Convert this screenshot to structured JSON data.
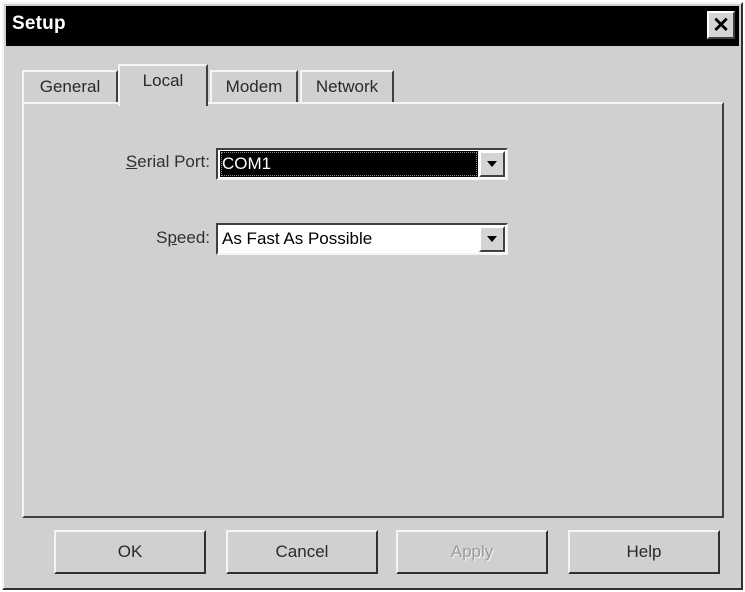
{
  "window": {
    "title": "Setup",
    "close_glyph": "✕"
  },
  "tabs": [
    {
      "label": "General",
      "active": false
    },
    {
      "label": "Local",
      "active": true
    },
    {
      "label": "Modem",
      "active": false
    },
    {
      "label": "Network",
      "active": false
    }
  ],
  "form": {
    "serial_port": {
      "label": "Serial Port:",
      "mnemonic": "S",
      "value": "COM1"
    },
    "speed": {
      "label": "Speed:",
      "mnemonic": "p",
      "value": "As Fast As Possible"
    }
  },
  "buttons": {
    "ok": "OK",
    "cancel": "Cancel",
    "apply": "Apply",
    "help": "Help"
  },
  "icons": {
    "close": "close-icon",
    "dropdown": "chevron-down-icon"
  }
}
